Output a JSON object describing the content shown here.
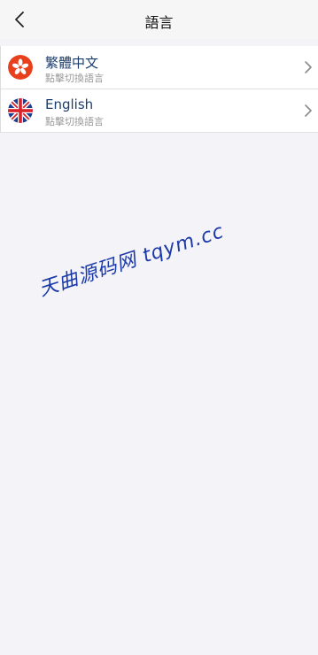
{
  "header": {
    "title": "語言",
    "back_icon": "chevron-left-icon"
  },
  "languages": [
    {
      "label": "繁體中文",
      "subtitle": "點擊切換語言",
      "flag_icon": "hong-kong-flag-icon",
      "flag_color": "#e8401c"
    },
    {
      "label": "English",
      "subtitle": "點擊切換語言",
      "flag_icon": "uk-flag-icon",
      "flag_color": "#1d3e8f"
    }
  ],
  "watermark": {
    "text": "天曲源码网 tqym.cc"
  }
}
